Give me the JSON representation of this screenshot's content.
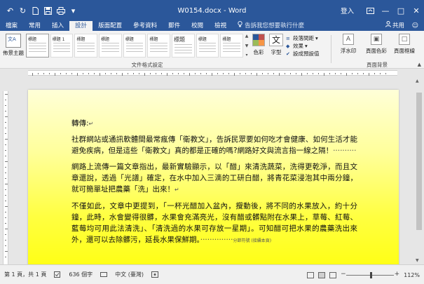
{
  "window": {
    "title": "W0154.docx - Word",
    "login": "登入",
    "restore_icon": "ribbon-display-icon",
    "minimize": "—",
    "maximize": "□",
    "close": "✕"
  },
  "qat": {
    "icons": [
      "autosave-icon",
      "undo-icon",
      "redo-icon",
      "file-icon",
      "save-icon",
      "print-icon",
      "customize-icon"
    ],
    "undo": "↶",
    "redo": "↻",
    "more": "▾"
  },
  "tabs": [
    {
      "label": "檔案",
      "active": false
    },
    {
      "label": "常用",
      "active": false
    },
    {
      "label": "插入",
      "active": false
    },
    {
      "label": "設計",
      "active": true
    },
    {
      "label": "版面配置",
      "active": false
    },
    {
      "label": "參考資料",
      "active": false
    },
    {
      "label": "郵件",
      "active": false
    },
    {
      "label": "校閱",
      "active": false
    },
    {
      "label": "檢視",
      "active": false
    }
  ],
  "tell_me": "告訴我您想要執行什麼",
  "share": "共用",
  "ribbon": {
    "themes_label": "佈景主題",
    "themes_glyph": "文A",
    "gallery": [
      {
        "title": "標題",
        "big": false
      },
      {
        "title": "標題 1",
        "big": false
      },
      {
        "title": "標題",
        "big": false
      },
      {
        "title": "標題",
        "big": false
      },
      {
        "title": "標題",
        "big": false
      },
      {
        "title": "標題",
        "big": false
      },
      {
        "title": "標題",
        "big": true
      },
      {
        "title": "標題",
        "big": false
      },
      {
        "title": "標題",
        "big": false
      }
    ],
    "doc_format_group": "文件格式設定",
    "colors_label": "色彩",
    "fonts_label": "字型",
    "fonts_glyph": "文",
    "para_spacing": "段落間距",
    "effects": "效果",
    "set_default": "設成預設值",
    "watermark": "浮水印",
    "page_color": "頁面色彩",
    "page_border": "頁面框線",
    "bg_group": "頁面背景",
    "colors": [
      "#2b579a",
      "#c0504d",
      "#9bbb59",
      "#f79646"
    ]
  },
  "doc": {
    "title": "轉傳:",
    "p1": "社群網站或通訊軟體間最常瘋傳「衛教文」，告訴民眾要如何吃才會健康、如何生活才能避免疾病，但是這些「衛教文」真的都是正確的嗎?網路好文與流言指一線之隔！",
    "p2": "網路上流傳一篇文章指出，最新實驗顯示，以「醋」來清洗蔬菜，洗得更乾淨，而且文章還說，透過「光譜」確定，在水中加入三滴的工研白醋，將青花菜浸泡其中兩分鐘，就可簡單址把農藥「洗」出來！",
    "p3": "不僅如此，文章中更提到，「一杯光醋加入盆內，攪動後，將不同的水果放入，約十分鐘，此時，水會變得很髒，水果會充滿亮光，沒有醋或髒點附在水果上，草莓、紅莓、藍莓均可用此法清洗」、「清洗過的水果可存放一星期」。可知醋可把水果的農藥洗出來外，還可以去除髒污，延長水果保鮮期。",
    "section_break": "分節符號 (接續本頁)"
  },
  "status": {
    "page": "第 1 頁，共 1 頁",
    "words": "636 個字",
    "lang": "中文 (臺灣)",
    "zoom": "112%",
    "zoom_minus": "−",
    "zoom_plus": "+",
    "zoom_value": 112
  }
}
